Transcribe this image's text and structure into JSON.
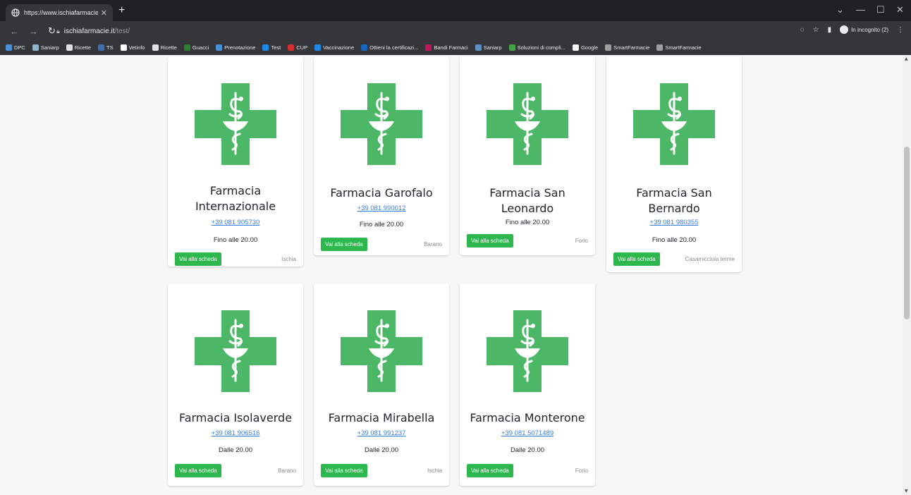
{
  "browser": {
    "tab_title": "https://www.ischiafarmacie.it/tes",
    "url_host": "ischiafarmacie.it",
    "url_path": "/test/",
    "profile_label": "In incognito (2)",
    "bookmarks": [
      {
        "label": "DPC",
        "color": "#4a90d9"
      },
      {
        "label": "Saniarp",
        "color": "#8fb3c8"
      },
      {
        "label": "Ricette",
        "color": "#dfe3e7"
      },
      {
        "label": "TS",
        "color": "#3c6fb0"
      },
      {
        "label": "Vetinfo",
        "color": "#ffffff"
      },
      {
        "label": "Ricette",
        "color": "#dfe3e7"
      },
      {
        "label": "Guacci",
        "color": "#2e7d32"
      },
      {
        "label": "Prenotazione",
        "color": "#4a90d9"
      },
      {
        "label": "Test",
        "color": "#1e88e5"
      },
      {
        "label": "CUP",
        "color": "#d32f2f"
      },
      {
        "label": "Vaccinazione",
        "color": "#1e88e5"
      },
      {
        "label": "Ottieni la certificazi...",
        "color": "#1565c0"
      },
      {
        "label": "Bandi Farmaci",
        "color": "#c2185b"
      },
      {
        "label": "Saniarp",
        "color": "#5c8fc0"
      },
      {
        "label": "Soluzioni di compli...",
        "color": "#43a047"
      },
      {
        "label": "Google",
        "color": "#f5f5f5"
      },
      {
        "label": "SmartFarmacie",
        "color": "#9e9e9e"
      },
      {
        "label": "SmartFarmacie",
        "color": "#9e9e9e"
      }
    ]
  },
  "theme": {
    "brand_green": "#4cb867",
    "button_green": "#2db84d",
    "link_blue": "#3b7ddd"
  },
  "cards": [
    {
      "name_line1": "Farmacia",
      "name_line2": "Internazionale",
      "phone": "+39 081 905730",
      "hours": "Fino alle 20.00",
      "button": "Vai alla scheda",
      "town": "Ischia"
    },
    {
      "name_line1": "Farmacia Garofalo",
      "name_line2": "",
      "phone": "+39 081 990012",
      "hours": "Fino alle 20.00",
      "button": "Vai alla scheda",
      "town": "Barano"
    },
    {
      "name_line1": "Farmacia San",
      "name_line2": "Leonardo",
      "phone": "",
      "hours": "Fino alle 20.00",
      "button": "Vai alla scheda",
      "town": "Forio"
    },
    {
      "name_line1": "Farmacia San",
      "name_line2": "Bernardo",
      "phone": "+39 081 980355",
      "hours": "Fino alle 20.00",
      "button": "Vai alla scheda",
      "town": "Casamicciola terme"
    },
    {
      "name_line1": "Farmacia Isolaverde",
      "name_line2": "",
      "phone": "+39 081 906516",
      "hours": "Dalle 20.00",
      "button": "Vai alla scheda",
      "town": "Barano"
    },
    {
      "name_line1": "Farmacia Mirabella",
      "name_line2": "",
      "phone": "+39 081 991237",
      "hours": "Dalle 20.00",
      "button": "Vai alla scheda",
      "town": "Ischia"
    },
    {
      "name_line1": "Farmacia Monterone",
      "name_line2": "",
      "phone": "+39 081 5071489",
      "hours": "Dalle 20.00",
      "button": "Vai alla scheda",
      "town": "Forio"
    }
  ]
}
